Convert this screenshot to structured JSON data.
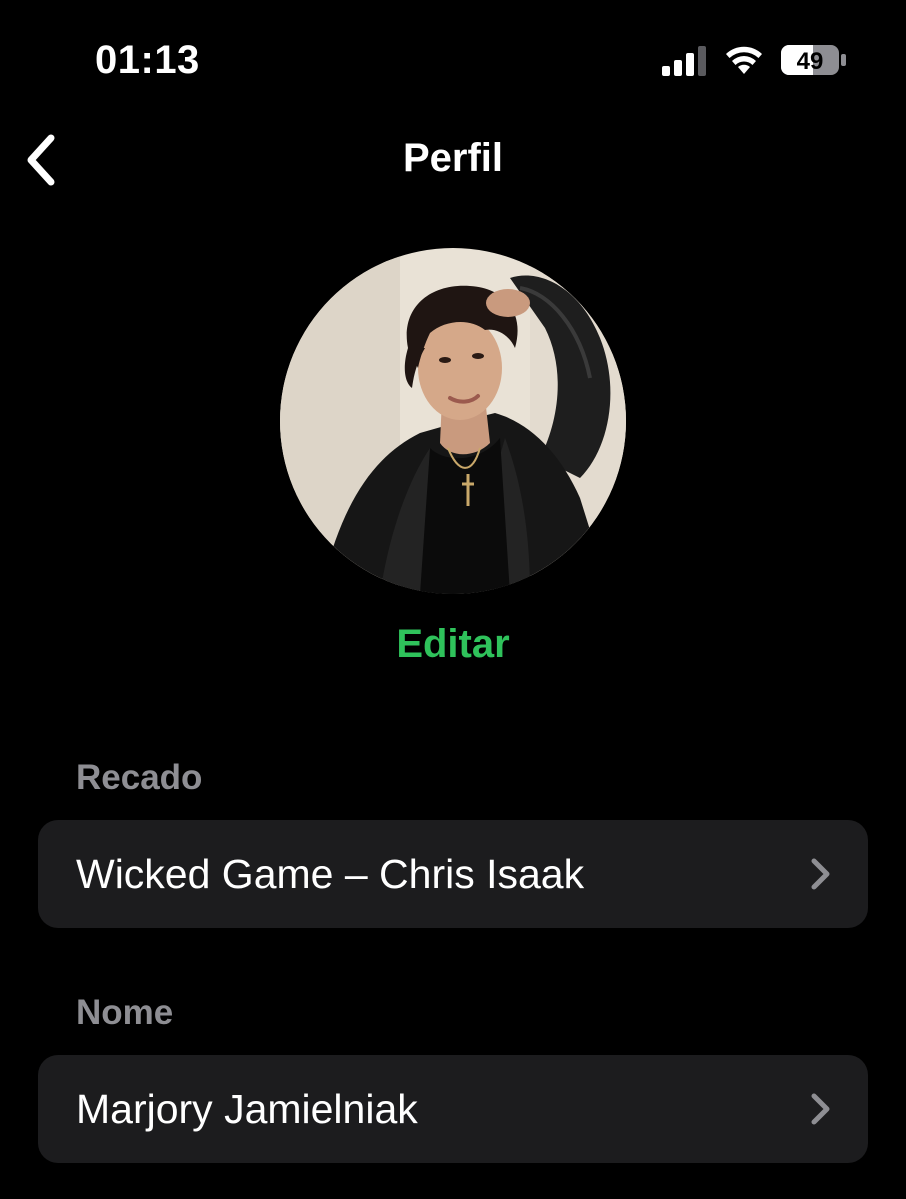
{
  "status_bar": {
    "time": "01:13",
    "battery": "49",
    "icons": [
      "signal-icon",
      "wifi-icon",
      "battery-icon"
    ]
  },
  "nav": {
    "back_icon": "chevron-left-icon",
    "title": "Perfil"
  },
  "profile": {
    "edit_label": "Editar"
  },
  "sections": {
    "status": {
      "label": "Recado",
      "value": "Wicked Game – Chris Isaak",
      "chevron_icon": "chevron-right-icon"
    },
    "name": {
      "label": "Nome",
      "value": "Marjory Jamielniak",
      "chevron_icon": "chevron-right-icon"
    }
  },
  "colors": {
    "background": "#000000",
    "row_background": "#1c1c1e",
    "accent": "#2fc25b",
    "secondary_text": "#8e8e93",
    "chevron": "#8e8e93"
  }
}
